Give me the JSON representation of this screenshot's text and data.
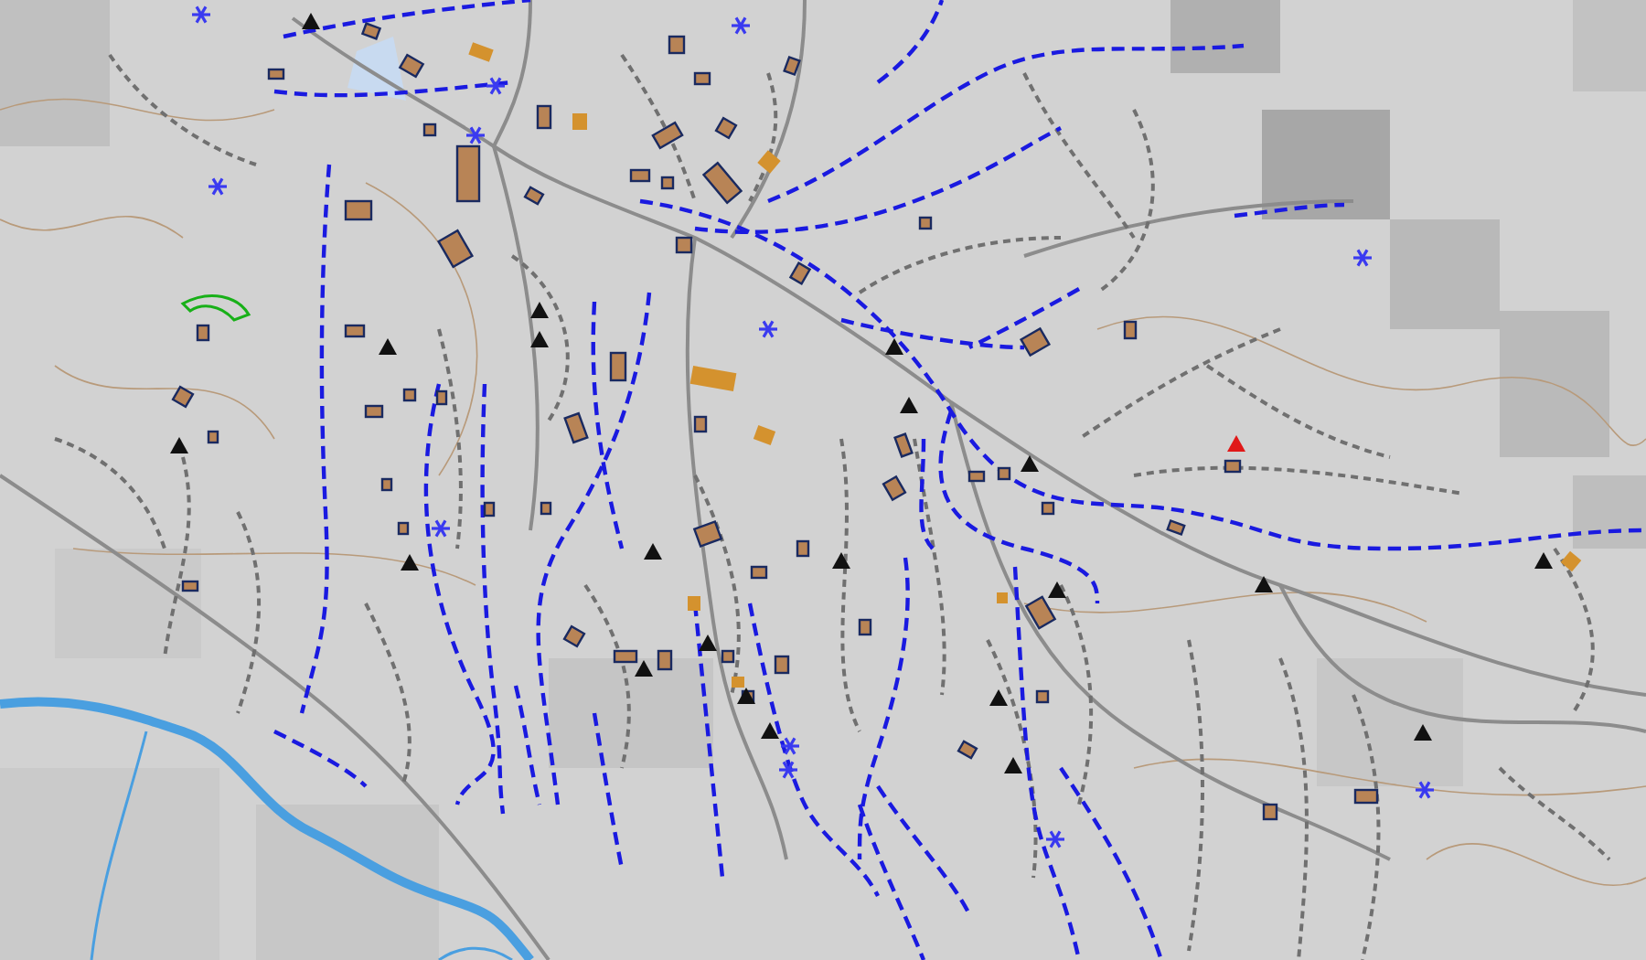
{
  "map": {
    "layers": [
      {
        "kind": "terrain"
      },
      {
        "kind": "contours"
      },
      {
        "kind": "rivers"
      },
      {
        "kind": "roads"
      },
      {
        "kind": "paths"
      },
      {
        "kind": "trails"
      },
      {
        "kind": "buildings"
      },
      {
        "kind": "peaks"
      },
      {
        "kind": "markers"
      }
    ]
  }
}
